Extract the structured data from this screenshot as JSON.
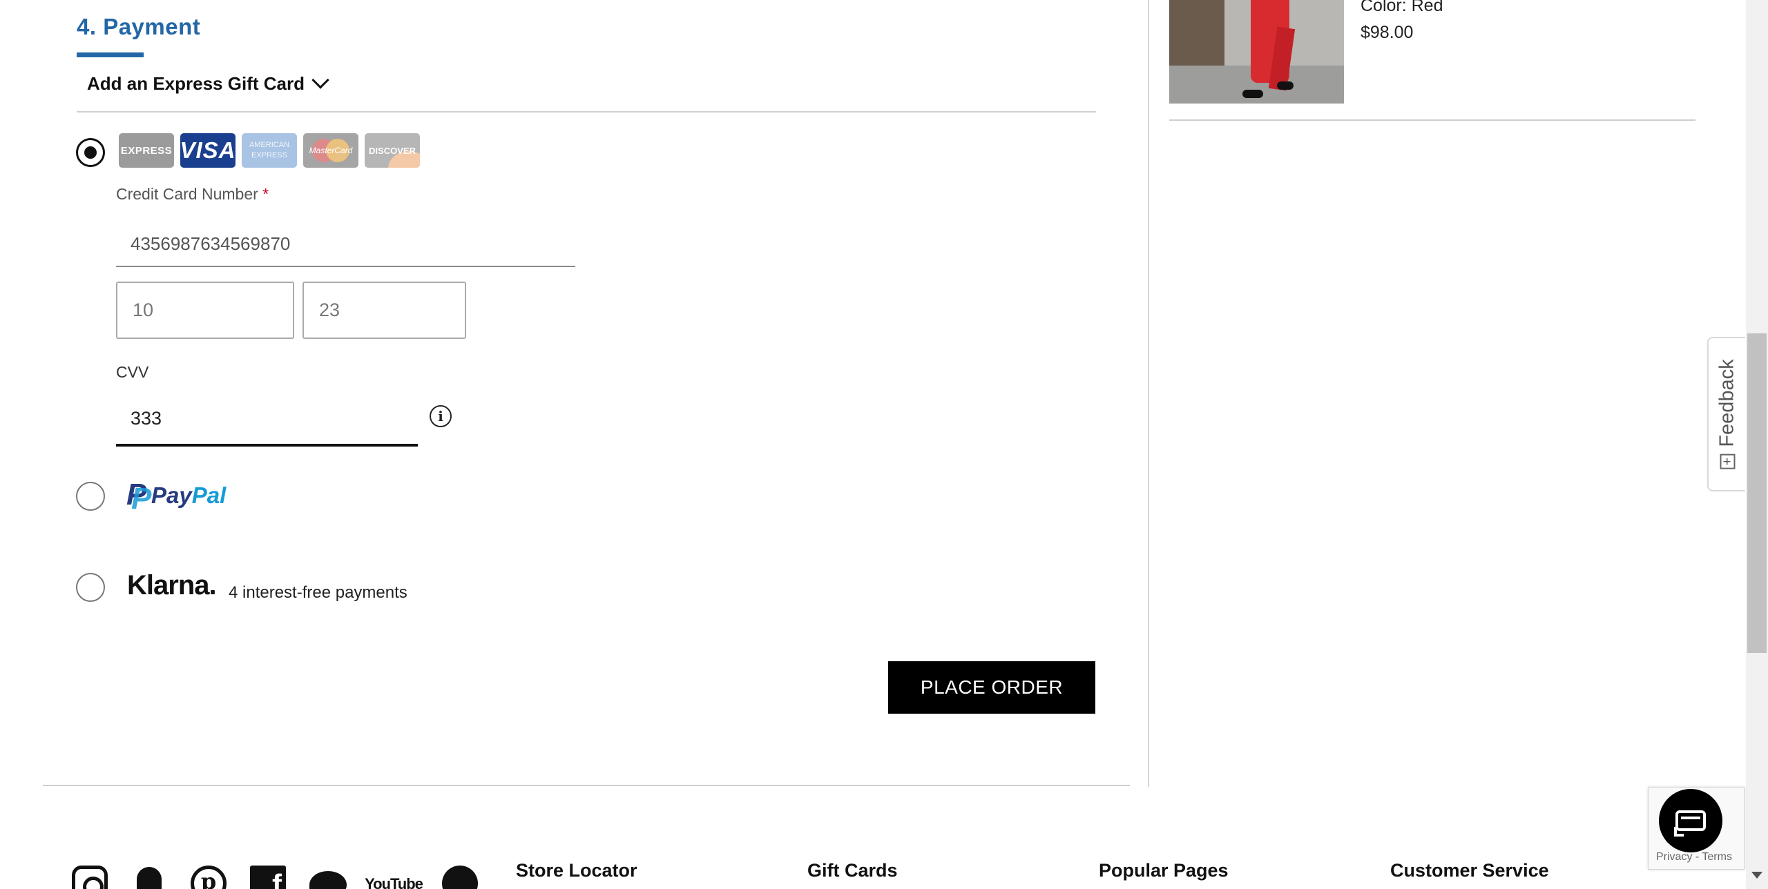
{
  "payment": {
    "section_title": "4. Payment",
    "gift_card_label": "Add an Express Gift Card",
    "card_logos": [
      "EXPRESS",
      "VISA",
      "AMERICAN EXPRESS",
      "MasterCard",
      "DISCOVER"
    ],
    "credit_card_label": "Credit Card Number",
    "required_mark": "*",
    "credit_card_value": "4356987634569870",
    "exp_month_value": "10",
    "exp_year_value": "23",
    "cvv_label": "CVV",
    "cvv_value": "333",
    "paypal_pay": "Pay",
    "paypal_pal": "Pal",
    "klarna_logo": "Klarna.",
    "klarna_text": "4 interest-free payments",
    "place_order_label": "PLACE ORDER"
  },
  "summary": {
    "product_color": "Color: Red",
    "product_price": "$98.00"
  },
  "feedback_label": "Feedback",
  "recaptcha_text": "Privacy - Terms",
  "footer": {
    "social_icons": [
      "instagram-icon",
      "snapchat-icon",
      "pinterest-icon",
      "facebook-icon",
      "twitter-icon",
      "youtube-icon",
      "spotify-icon"
    ],
    "youtube_text": "YouTube",
    "columns": [
      "Store Locator",
      "Gift Cards",
      "Popular Pages",
      "Customer Service"
    ]
  },
  "colors": {
    "accent": "#2467a6",
    "button": "#000000",
    "required": "#d0021b"
  }
}
